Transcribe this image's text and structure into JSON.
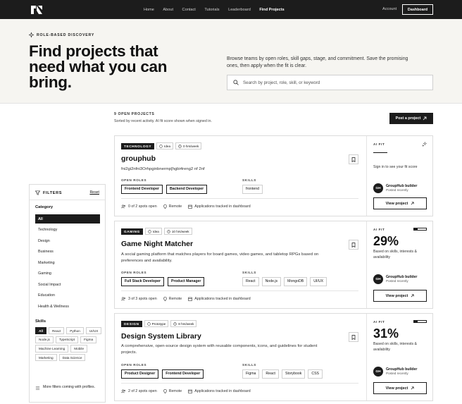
{
  "nav": {
    "links": [
      "Home",
      "About",
      "Contact",
      "Tutorials",
      "Leaderboard",
      "Find Projects"
    ],
    "active_index": 5,
    "account": "Account",
    "dashboard": "Dashboard"
  },
  "hero": {
    "eyebrow": "ROLE-BASED DISCOVERY",
    "title_line1": "Find projects that",
    "title_line2": "need what you can",
    "title_line3": "bring.",
    "lede": "Browse teams by open roles, skill gaps, stage, and commitment. Save the promising ones, then apply when the fit is clear.",
    "search_placeholder": "Search by project, role, skill, or keyword"
  },
  "list": {
    "count": "9 OPEN PROJECTS",
    "sorted": "Sorted by recent activity. AI fit score shown when signed in.",
    "post_button": "Post a project"
  },
  "filters": {
    "title": "FILTERS",
    "reset": "Reset",
    "category_title": "Category",
    "categories": [
      "All",
      "Technology",
      "Design",
      "Business",
      "Marketing",
      "Gaming",
      "Social Impact",
      "Education",
      "Health & Wellness"
    ],
    "selected_category": 0,
    "skills_title": "Skills",
    "skills": [
      "All",
      "React",
      "Python",
      "UI/UX",
      "Node.js",
      "TypeScript",
      "Figma",
      "Machine Learning",
      "Mobile",
      "Marketing",
      "Data Science"
    ],
    "more": "More filters coming with profiles."
  },
  "cards": [
    {
      "category": "TECHNOLOGY",
      "stage": "Idea",
      "hours": "0 hrs/week",
      "title": "grouphub",
      "desc": "fni2gi2nfni3Orhpginbnermp[hgbi4reng2 nf 2nf",
      "roles_label": "OPEN ROLES",
      "roles": [
        "Frontend Developer",
        "Backend Developer"
      ],
      "skills_label": "SKILLS",
      "skills": [
        "frontend"
      ],
      "spots": "0 of 2 spots open",
      "location": "Remote",
      "tracked": "Applications tracked in dashboard",
      "ai_label": "AI FIT",
      "fit": "——",
      "fit_fraction": 0,
      "fit_note": "Sign in to see your fit score",
      "owner_initials": "GH",
      "owner": "GroupHub builder",
      "posted": "Posted recently",
      "view": "View project"
    },
    {
      "category": "GAMING",
      "stage": "Idea",
      "hours": "10 hrs/week",
      "title": "Game Night Matcher",
      "desc": "A social gaming platform that matches players for board games, video games, and tabletop RPGs based on preferences and availability.",
      "roles_label": "OPEN ROLES",
      "roles": [
        "Full Stack Developer",
        "Product Manager"
      ],
      "skills_label": "SKILLS",
      "skills": [
        "React",
        "Node.js",
        "MongoDB",
        "UI/UX"
      ],
      "spots": "3 of 3 spots open",
      "location": "Remote",
      "tracked": "Applications tracked in dashboard",
      "ai_label": "AI FIT",
      "fit": "29%",
      "fit_fraction": 0.29,
      "fit_note": "Based on skills, interests & availability",
      "owner_initials": "GH",
      "owner": "GroupHub builder",
      "posted": "Posted recently",
      "view": "View project"
    },
    {
      "category": "DESIGN",
      "stage": "Prototype",
      "hours": "8 hrs/week",
      "title": "Design System Library",
      "desc": "A comprehensive, open-source design system with reusable components, icons, and guidelines for student projects.",
      "roles_label": "OPEN ROLES",
      "roles": [
        "Product Designer",
        "Frontend Developer"
      ],
      "skills_label": "SKILLS",
      "skills": [
        "Figma",
        "React",
        "Storybook",
        "CSS"
      ],
      "spots": "2 of 2 spots open",
      "location": "Remote",
      "tracked": "Applications tracked in dashboard",
      "ai_label": "AI FIT",
      "fit": "31%",
      "fit_fraction": 0.31,
      "fit_note": "Based on skills, interests & availability",
      "owner_initials": "GH",
      "owner": "GroupHub builder",
      "posted": "Posted recently",
      "view": "View project"
    }
  ]
}
